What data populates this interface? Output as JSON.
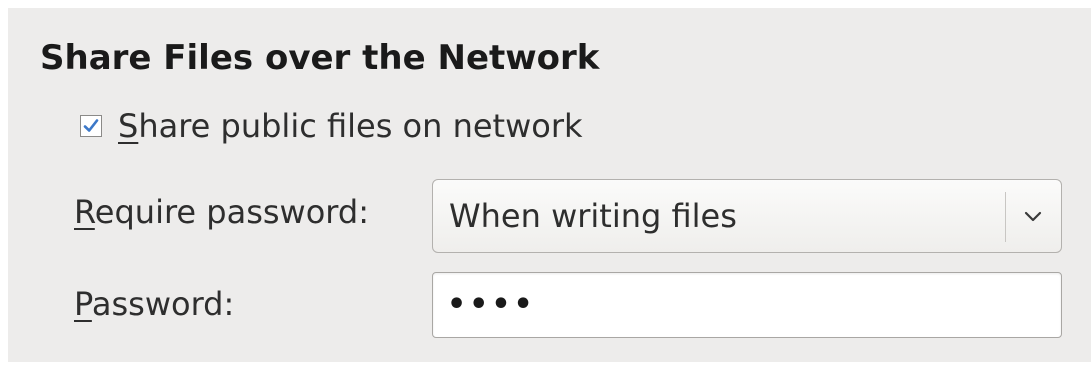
{
  "section": {
    "title": "Share Files over the Network"
  },
  "share_checkbox": {
    "mnemonic": "S",
    "label_rest": "hare public files on network",
    "checked": true
  },
  "require_password": {
    "mnemonic": "R",
    "label_rest": "equire password:",
    "selected": "When writing files"
  },
  "password": {
    "mnemonic": "P",
    "label_rest": "assword:",
    "masked_value": "••••"
  },
  "icons": {
    "checkbox_mark": "check-icon",
    "dropdown": "chevron-down-icon"
  },
  "colors": {
    "panel_bg": "#edeceb",
    "check_mark": "#3c78c8"
  }
}
